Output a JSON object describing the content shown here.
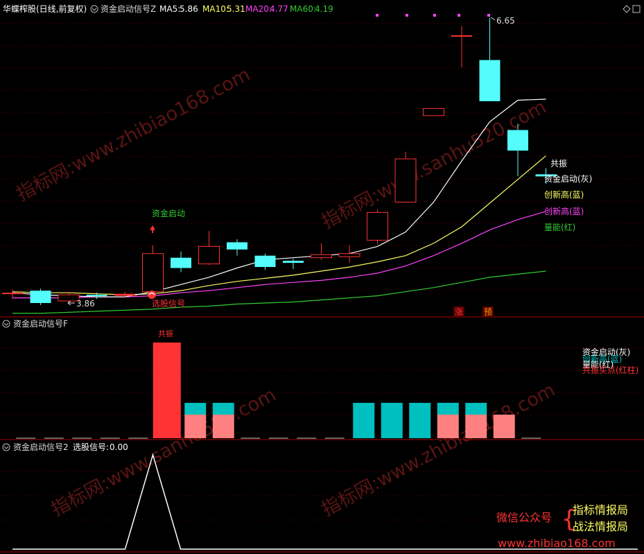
{
  "colors": {
    "up": "#ff3333",
    "down": "#54fcfc",
    "ma5": "#ffffff",
    "ma10": "#ffff66",
    "ma20": "#ff44ff",
    "ma60": "#33cc33",
    "divider": "#aa0000",
    "grid": "#3a0000",
    "teal": "#00bfbf",
    "pink": "#ff8080",
    "watermark": "#5a1414"
  },
  "top_panel": {
    "header": {
      "stock": "华蝶榨股(日线,前复权)",
      "indicator": "资金启动信号Z",
      "ma5_label": "MA5:",
      "ma5_value": "5.86",
      "ma10_label": "MA10:",
      "ma10_value": "5.31",
      "ma20_label": "MA20:",
      "ma20_value": "4.77",
      "ma60_label": "MA60:",
      "ma60_value": "4.19"
    },
    "annotations": {
      "high_price": "6.65",
      "low_price": "3.86",
      "fund_start": "资金启动",
      "select_signal": "选股信号",
      "resonance": "共振",
      "tag_up": "涨",
      "tag_pre": "预"
    },
    "legend": [
      {
        "text": "资金启动(灰)",
        "color": "#ffffff"
      },
      {
        "text": "创新高(蓝)",
        "color": "#ffff66"
      },
      {
        "text": "创新高(蓝)",
        "color": "#ff44ff"
      },
      {
        "text": "量能(红)",
        "color": "#33cc33"
      }
    ]
  },
  "mid_panel": {
    "title": "资金启动信号F",
    "resonance_label": "共振",
    "legend": [
      {
        "text": "资金启动(灰)",
        "color": "#ffffff"
      },
      {
        "text": "创新高(蓝)",
        "color": "#00bfbf"
      },
      {
        "text": "量能(红)",
        "color": "#ffffff"
      },
      {
        "text": "共振买点(红柱)",
        "color": "#ff3333"
      }
    ]
  },
  "bot_panel": {
    "title": "资金启动信号2",
    "signal_label": "选股信号:",
    "signal_value": "0.00"
  },
  "branding": {
    "wechat": "微信公众号",
    "brace": "{",
    "line1": "指标情报局",
    "line2": "战法情报局",
    "url": "www.zhibiao168.com"
  },
  "watermarks": [
    "指标网:www.zhibiao168.com",
    "指标网:www.sanhu520.com"
  ],
  "chart_data": {
    "type": "candlestick",
    "candles": [
      {
        "open": 3.98,
        "close": 3.98,
        "high": 4.01,
        "low": 3.92
      },
      {
        "open": 4.0,
        "close": 3.88,
        "high": 4.02,
        "low": 3.86
      },
      {
        "open": 3.9,
        "close": 3.96,
        "high": 3.99,
        "low": 3.88
      },
      {
        "open": 3.96,
        "close": 3.95,
        "high": 3.98,
        "low": 3.92
      },
      {
        "open": 3.95,
        "close": 3.97,
        "high": 3.99,
        "low": 3.93
      },
      {
        "open": 3.99,
        "close": 4.36,
        "high": 4.44,
        "low": 3.99
      },
      {
        "open": 4.32,
        "close": 4.22,
        "high": 4.38,
        "low": 4.18
      },
      {
        "open": 4.26,
        "close": 4.43,
        "high": 4.58,
        "low": 4.25
      },
      {
        "open": 4.47,
        "close": 4.4,
        "high": 4.5,
        "low": 4.34
      },
      {
        "open": 4.34,
        "close": 4.23,
        "high": 4.36,
        "low": 4.2
      },
      {
        "open": 4.29,
        "close": 4.27,
        "high": 4.31,
        "low": 4.21
      },
      {
        "open": 4.32,
        "close": 4.35,
        "high": 4.46,
        "low": 4.3
      },
      {
        "open": 4.33,
        "close": 4.36,
        "high": 4.44,
        "low": 4.27
      },
      {
        "open": 4.49,
        "close": 4.76,
        "high": 4.79,
        "low": 4.45
      },
      {
        "open": 4.86,
        "close": 5.28,
        "high": 5.35,
        "low": 4.86
      },
      {
        "open": 5.7,
        "close": 5.77,
        "high": 5.77,
        "low": 5.7
      },
      {
        "open": 6.48,
        "close": 6.48,
        "high": 6.57,
        "low": 6.17
      },
      {
        "open": 6.24,
        "close": 5.84,
        "high": 6.65,
        "low": 5.84
      },
      {
        "open": 5.56,
        "close": 5.36,
        "high": 5.62,
        "low": 5.11
      },
      {
        "open": 5.13,
        "close": 5.11,
        "high": 5.19,
        "low": 5.04
      }
    ],
    "ma5": [
      3.98,
      3.96,
      3.95,
      3.94,
      3.94,
      3.99,
      4.06,
      4.13,
      4.22,
      4.3,
      4.32,
      4.34,
      4.36,
      4.43,
      4.57,
      4.86,
      5.26,
      5.64,
      5.85,
      5.86
    ],
    "ma10": [
      3.99,
      3.98,
      3.98,
      3.97,
      3.96,
      3.97,
      4.0,
      4.05,
      4.09,
      4.12,
      4.15,
      4.19,
      4.23,
      4.28,
      4.34,
      4.46,
      4.62,
      4.85,
      5.08,
      5.31
    ],
    "ma20": [
      3.93,
      3.93,
      3.93,
      3.94,
      3.94,
      3.95,
      3.98,
      4.0,
      4.03,
      4.06,
      4.08,
      4.1,
      4.13,
      4.17,
      4.24,
      4.34,
      4.46,
      4.59,
      4.69,
      4.77
    ],
    "ma60": [
      3.78,
      3.78,
      3.79,
      3.8,
      3.81,
      3.82,
      3.84,
      3.85,
      3.87,
      3.88,
      3.89,
      3.91,
      3.93,
      3.95,
      3.99,
      4.03,
      4.08,
      4.13,
      4.16,
      4.19
    ],
    "f_bars": [
      {
        "red": 0,
        "pink": 0,
        "teal": 0
      },
      {
        "red": 0,
        "pink": 0,
        "teal": 0
      },
      {
        "red": 0,
        "pink": 0,
        "teal": 0
      },
      {
        "red": 0,
        "pink": 0,
        "teal": 0
      },
      {
        "red": 0,
        "pink": 0,
        "teal": 0
      },
      {
        "red": 1,
        "pink": 0,
        "teal": 0
      },
      {
        "red": 0,
        "pink": 1,
        "teal": 1
      },
      {
        "red": 0,
        "pink": 1,
        "teal": 1
      },
      {
        "red": 0,
        "pink": 0,
        "teal": 0
      },
      {
        "red": 0,
        "pink": 0,
        "teal": 0
      },
      {
        "red": 0,
        "pink": 0,
        "teal": 0
      },
      {
        "red": 0,
        "pink": 0,
        "teal": 0
      },
      {
        "red": 0,
        "pink": 0,
        "teal": 1
      },
      {
        "red": 0,
        "pink": 0,
        "teal": 1
      },
      {
        "red": 0,
        "pink": 0,
        "teal": 1
      },
      {
        "red": 0,
        "pink": 1,
        "teal": 1
      },
      {
        "red": 0,
        "pink": 1,
        "teal": 1
      },
      {
        "red": 0,
        "pink": 1,
        "teal": 0
      },
      {
        "red": 0,
        "pink": 0,
        "teal": 0
      }
    ],
    "select_signal": [
      0,
      0,
      0,
      0,
      0,
      1,
      0,
      0,
      0,
      0,
      0,
      0,
      0,
      0,
      0,
      0,
      0,
      0,
      0,
      0
    ]
  }
}
